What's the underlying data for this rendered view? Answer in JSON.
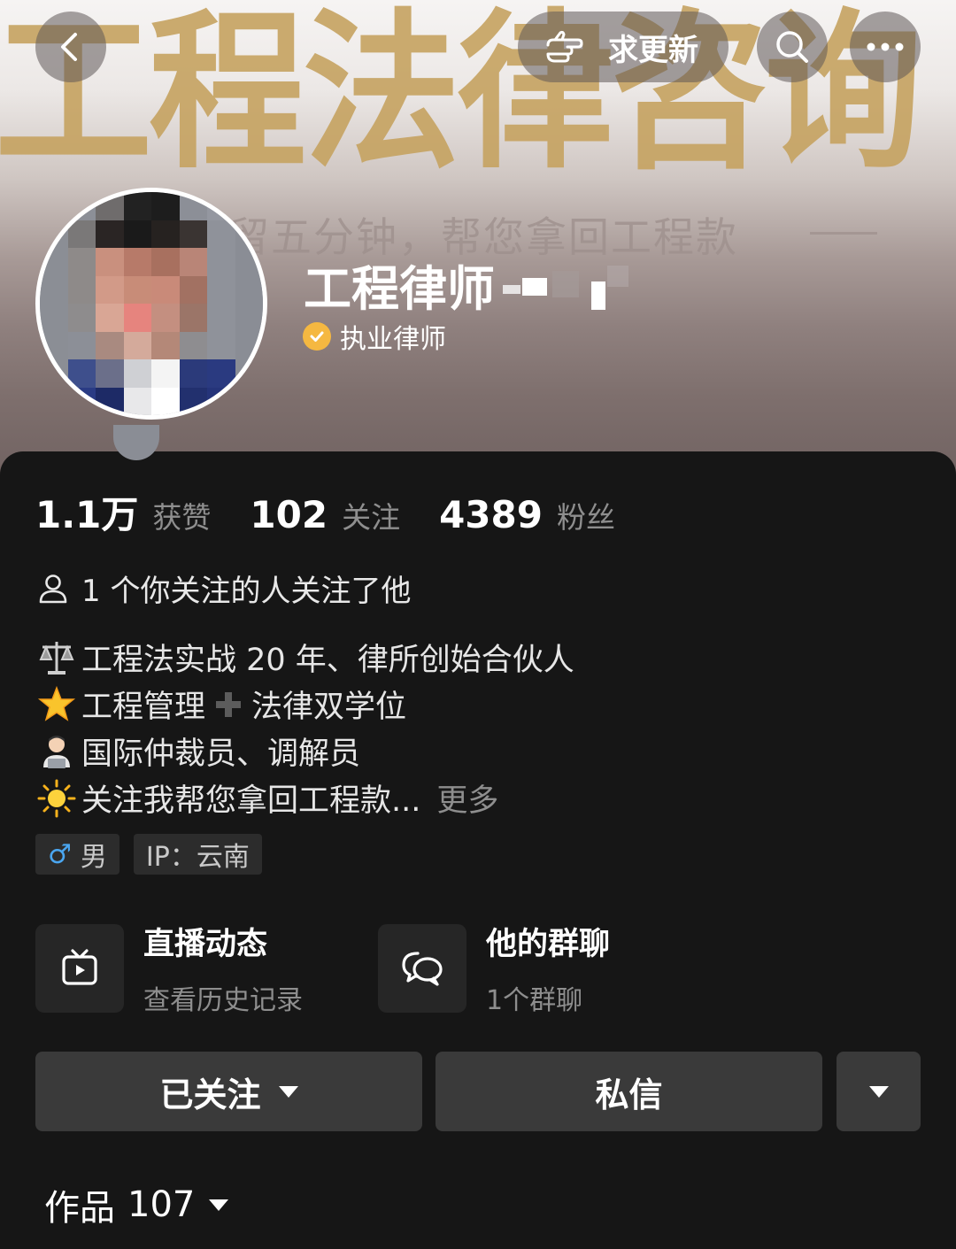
{
  "banner": {
    "title": "工程法律咨询",
    "subtitle": "留五分钟，帮您拿回工程款",
    "update_label": "求更新"
  },
  "profile": {
    "name": "工程律师",
    "verify_label": "执业律师",
    "verify_color": "#f5b841"
  },
  "stats": [
    {
      "num": "1.1万",
      "label": "获赞"
    },
    {
      "num": "102",
      "label": "关注"
    },
    {
      "num": "4389",
      "label": "粉丝"
    }
  ],
  "mutual_text": "1 个你关注的人关注了他",
  "bio": {
    "lines": [
      {
        "icon": "scales-icon",
        "text": "工程法实战 20 年、律所创始合伙人"
      },
      {
        "icon": "glowing-star-icon",
        "text": "工程管理",
        "plus": "plus-icon",
        "text2": "法律双学位"
      },
      {
        "icon": "person-laptop-icon",
        "text": "国际仲裁员、调解员"
      },
      {
        "icon": "sun-icon",
        "text": "关注我帮您拿回工程款..."
      }
    ],
    "more": "更多"
  },
  "tags": {
    "gender_symbol": "♂",
    "gender": "男",
    "ip": "IP：云南"
  },
  "features": [
    {
      "icon": "tv-icon",
      "title": "直播动态",
      "sub": "查看历史记录"
    },
    {
      "icon": "chat-bubbles-icon",
      "title": "他的群聊",
      "sub": "1个群聊"
    }
  ],
  "actions": {
    "follow": "已关注",
    "message": "私信"
  },
  "works": {
    "label": "作品",
    "count": "107"
  }
}
